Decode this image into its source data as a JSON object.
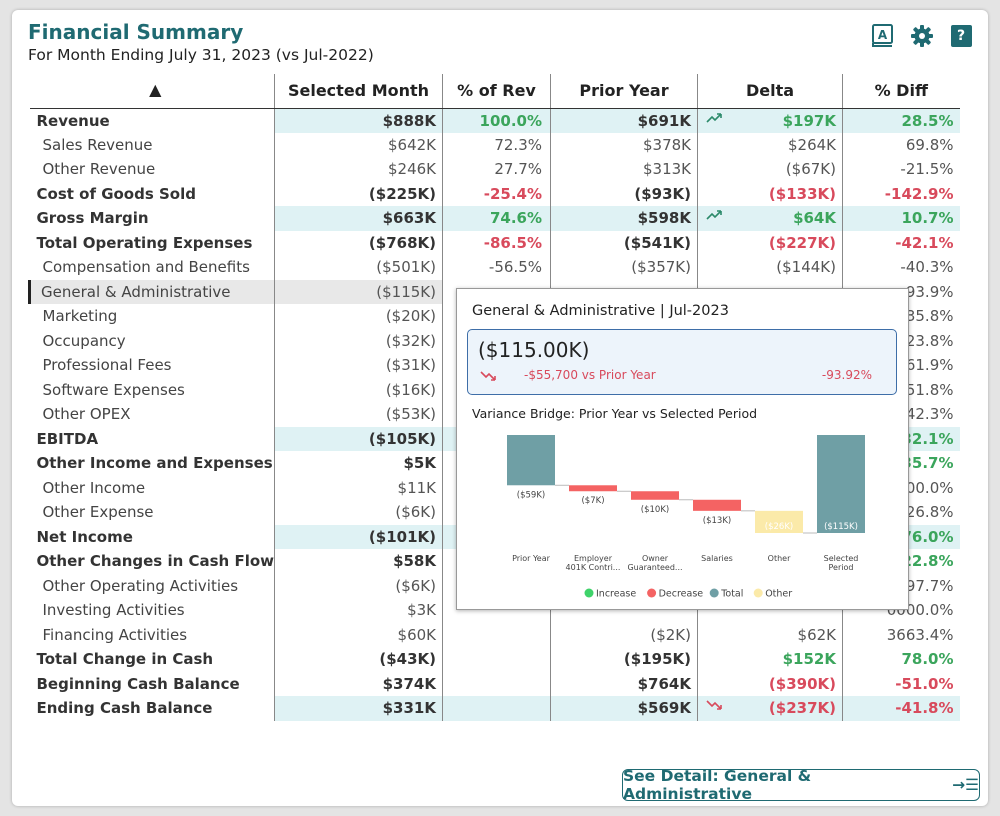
{
  "header": {
    "title": "Financial Summary",
    "subtitle": "For Month Ending July 31, 2023 (vs Jul-2022)",
    "icons": [
      "book-icon",
      "gear-icon",
      "help-icon"
    ],
    "help_glyph": "?",
    "book_glyph": "A"
  },
  "table": {
    "sort_glyph": "▲",
    "columns": [
      "Selected Month",
      "% of Rev",
      "Prior Year",
      "Delta",
      "% Diff"
    ],
    "rows": [
      {
        "label": "Revenue",
        "selected": "$888K",
        "pct": "100.0%",
        "prior": "$691K",
        "trend": "up",
        "delta": "$197K",
        "diff": "28.5%"
      },
      {
        "label": "Sales Revenue",
        "selected": "$642K",
        "pct": "72.3%",
        "prior": "$378K",
        "trend": "",
        "delta": "$264K",
        "diff": "69.8%"
      },
      {
        "label": "Other Revenue",
        "selected": "$246K",
        "pct": "27.7%",
        "prior": "$313K",
        "trend": "",
        "delta": "($67K)",
        "diff": "-21.5%"
      },
      {
        "label": "Cost of Goods Sold",
        "selected": "($225K)",
        "pct": "-25.4%",
        "prior": "($93K)",
        "trend": "",
        "delta": "($133K)",
        "diff": "-142.9%"
      },
      {
        "label": "Gross Margin",
        "selected": "$663K",
        "pct": "74.6%",
        "prior": "$598K",
        "trend": "up",
        "delta": "$64K",
        "diff": "10.7%"
      },
      {
        "label": "Total Operating Expenses",
        "selected": "($768K)",
        "pct": "-86.5%",
        "prior": "($541K)",
        "trend": "",
        "delta": "($227K)",
        "diff": "-42.1%"
      },
      {
        "label": "Compensation and Benefits",
        "selected": "($501K)",
        "pct": "-56.5%",
        "prior": "($357K)",
        "trend": "",
        "delta": "($144K)",
        "diff": "-40.3%"
      },
      {
        "label": "General & Administrative",
        "selected": "($115K)",
        "pct": "",
        "prior": "",
        "trend": "",
        "delta": "",
        "diff": "93.9%"
      },
      {
        "label": "Marketing",
        "selected": "($20K)",
        "pct": "",
        "prior": "",
        "trend": "",
        "delta": "",
        "diff": "35.8%"
      },
      {
        "label": "Occupancy",
        "selected": "($32K)",
        "pct": "",
        "prior": "",
        "trend": "",
        "delta": "",
        "diff": "23.8%"
      },
      {
        "label": "Professional Fees",
        "selected": "($31K)",
        "pct": "",
        "prior": "",
        "trend": "",
        "delta": "",
        "diff": "61.9%"
      },
      {
        "label": "Software Expenses",
        "selected": "($16K)",
        "pct": "",
        "prior": "",
        "trend": "",
        "delta": "",
        "diff": "51.8%"
      },
      {
        "label": "Other OPEX",
        "selected": "($53K)",
        "pct": "",
        "prior": "",
        "trend": "",
        "delta": "",
        "diff": "42.3%"
      },
      {
        "label": "EBITDA",
        "selected": "($105K)",
        "pct": "",
        "prior": "",
        "trend": "",
        "delta": "",
        "diff": "32.1%"
      },
      {
        "label": "Other Income and Expenses",
        "selected": "$5K",
        "pct": "",
        "prior": "",
        "trend": "",
        "delta": "",
        "diff": "35.7%"
      },
      {
        "label": "Other Income",
        "selected": "$11K",
        "pct": "",
        "prior": "",
        "trend": "",
        "delta": "",
        "diff": "00.0%"
      },
      {
        "label": "Other Expense",
        "selected": "($6K)",
        "pct": "",
        "prior": "",
        "trend": "",
        "delta": "",
        "diff": "26.8%"
      },
      {
        "label": "Net Income",
        "selected": "($101K)",
        "pct": "",
        "prior": "",
        "trend": "",
        "delta": "",
        "diff": "76.0%"
      },
      {
        "label": "Other Changes in Cash Flow",
        "selected": "$58K",
        "pct": "",
        "prior": "",
        "trend": "",
        "delta": "",
        "diff": "22.8%"
      },
      {
        "label": "Other Operating Activities",
        "selected": "($6K)",
        "pct": "",
        "prior": "",
        "trend": "",
        "delta": "",
        "diff": "97.7%"
      },
      {
        "label": "Investing Activities",
        "selected": "$3K",
        "pct": "",
        "prior": "",
        "trend": "",
        "delta": "",
        "diff": "0000.0%"
      },
      {
        "label": "Financing Activities",
        "selected": "$60K",
        "pct": "",
        "prior": "($2K)",
        "trend": "",
        "delta": "$62K",
        "diff": "3663.4%"
      },
      {
        "label": "Total Change in Cash",
        "selected": "($43K)",
        "pct": "",
        "prior": "($195K)",
        "trend": "",
        "delta": "$152K",
        "diff": "78.0%"
      },
      {
        "label": "Beginning Cash Balance",
        "selected": "$374K",
        "pct": "",
        "prior": "$764K",
        "trend": "",
        "delta": "($390K)",
        "diff": "-51.0%"
      },
      {
        "label": "Ending Cash Balance",
        "selected": "$331K",
        "pct": "",
        "prior": "$569K",
        "trend": "down",
        "delta": "($237K)",
        "diff": "-41.8%"
      }
    ]
  },
  "tooltip": {
    "title": "General & Administrative | Jul-2023",
    "value": "($115.00K)",
    "variance_text": "-$55,700  vs Prior Year",
    "variance_pct": "-93.92%",
    "bridge_title": "Variance Bridge: Prior Year vs Selected Period"
  },
  "chart_data": {
    "type": "bar",
    "subtype": "waterfall",
    "title": "Variance Bridge: Prior Year vs Selected Period",
    "categories": [
      "Prior Year",
      "Employer 401K Contri...",
      "Owner Guaranteed...",
      "Salaries",
      "Other",
      "Selected Period"
    ],
    "values": [
      -59,
      -7,
      -10,
      -13,
      -26,
      -115
    ],
    "value_labels": [
      "($59K)",
      "($7K)",
      "($10K)",
      "($13K)",
      "($26K)",
      "($115K)"
    ],
    "kinds": [
      "total",
      "decrease",
      "decrease",
      "decrease",
      "other",
      "total"
    ],
    "legend": [
      "Increase",
      "Decrease",
      "Total",
      "Other"
    ],
    "colors": {
      "Increase": "#3fd36a",
      "Decrease": "#f46363",
      "Total": "#6f9fa5",
      "Other": "#fbeaa9"
    },
    "ylim": [
      -115,
      0
    ]
  },
  "footer": {
    "detail_button": "See Detail: General & Administrative",
    "detail_icon": "→☰"
  },
  "colors": {
    "accent": "#1f6a72",
    "positive": "#3ba55c",
    "negative": "#d84a5c",
    "highlight_row": "#dff2f4"
  }
}
